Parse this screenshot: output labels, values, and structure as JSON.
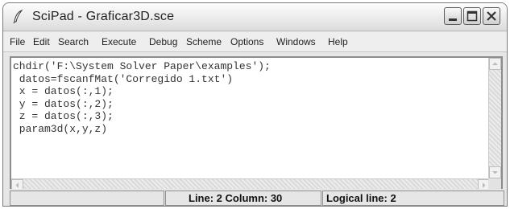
{
  "window": {
    "title": "SciPad - Graficar3D.sce"
  },
  "menu": [
    "File",
    "Edit",
    "Search",
    "Execute",
    "Debug",
    "Scheme",
    "Options",
    "Windows",
    "Help"
  ],
  "editor": {
    "lines": [
      "chdir('F:\\System Solver Paper\\examples');",
      " datos=fscanfMat('Corregido 1.txt')",
      " x = datos(:,1);",
      " y = datos(:,2);",
      " z = datos(:,3);",
      " param3d(x,y,z)"
    ]
  },
  "status": {
    "message": "",
    "line_column": "Line: 2 Column: 30",
    "logical_line": "Logical line: 2"
  },
  "icons": {
    "app": "scipad-feather-icon",
    "minimize": "minimize-icon",
    "maximize": "maximize-icon",
    "close": "close-icon"
  }
}
